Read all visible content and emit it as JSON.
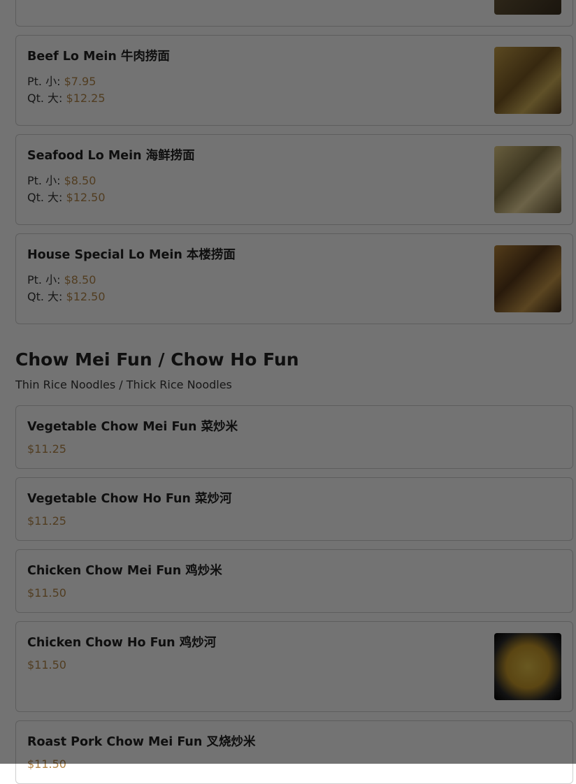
{
  "lo_mein_items": [
    {
      "name": "Beef Lo Mein 牛肉捞面",
      "pt_label": "Pt. 小:",
      "pt_price": "$7.95",
      "qt_label": "Qt. 大:",
      "qt_price": "$12.25"
    },
    {
      "name": "Seafood Lo Mein 海鲜捞面",
      "pt_label": "Pt. 小:",
      "pt_price": "$8.50",
      "qt_label": "Qt. 大:",
      "qt_price": "$12.50"
    },
    {
      "name": "House Special Lo Mein 本楼捞面",
      "pt_label": "Pt. 小:",
      "pt_price": "$8.50",
      "qt_label": "Qt. 大:",
      "qt_price": "$12.50"
    }
  ],
  "chow_section": {
    "title": "Chow Mei Fun / Chow Ho Fun",
    "subtitle": "Thin Rice Noodles / Thick Rice Noodles",
    "items": [
      {
        "name": "Vegetable Chow Mei Fun 菜炒米",
        "price": "$11.25"
      },
      {
        "name": "Vegetable Chow Ho Fun 菜炒河",
        "price": "$11.25"
      },
      {
        "name": "Chicken Chow Mei Fun 鸡炒米",
        "price": "$11.50"
      },
      {
        "name": "Chicken Chow Ho Fun 鸡炒河",
        "price": "$11.50"
      },
      {
        "name": "Roast Pork Chow Mei Fun 叉烧炒米",
        "price": "$11.50"
      }
    ]
  },
  "colors": {
    "price": "#b4874a",
    "overlay": "rgba(0,0,0,0.55)"
  }
}
